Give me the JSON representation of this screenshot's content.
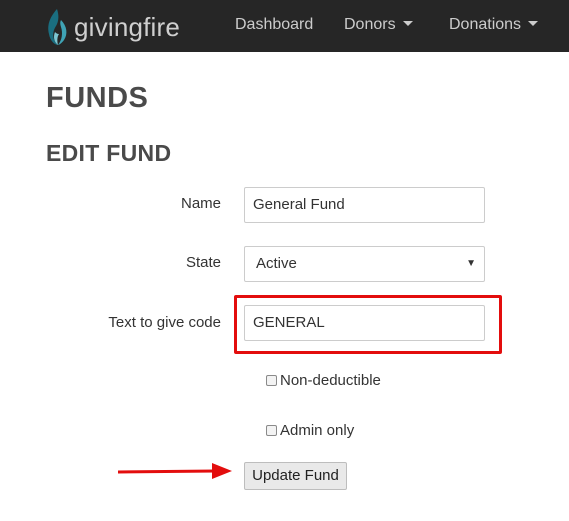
{
  "brand": {
    "name": "givingfire",
    "icon": "flame-logo-icon",
    "colors": {
      "flame_dark": "#1a6e80",
      "flame_light": "#3fa3b5"
    }
  },
  "nav": {
    "items": [
      {
        "label": "Dashboard",
        "dropdown": false
      },
      {
        "label": "Donors",
        "dropdown": true
      },
      {
        "label": "Donations",
        "dropdown": true
      }
    ]
  },
  "page": {
    "title": "FUNDS",
    "subtitle": "EDIT FUND"
  },
  "form": {
    "name": {
      "label": "Name",
      "value": "General Fund"
    },
    "state": {
      "label": "State",
      "value": "Active"
    },
    "text_to_give": {
      "label": "Text to give code",
      "value": "GENERAL"
    },
    "non_deductible": {
      "label": "Non-deductible",
      "checked": false
    },
    "admin_only": {
      "label": "Admin only",
      "checked": false
    },
    "submit_label": "Update Fund"
  },
  "annotations": {
    "color": "#e30d0d",
    "highlight_target": "text-to-give-code-field",
    "arrow_target": "update-fund-button"
  }
}
